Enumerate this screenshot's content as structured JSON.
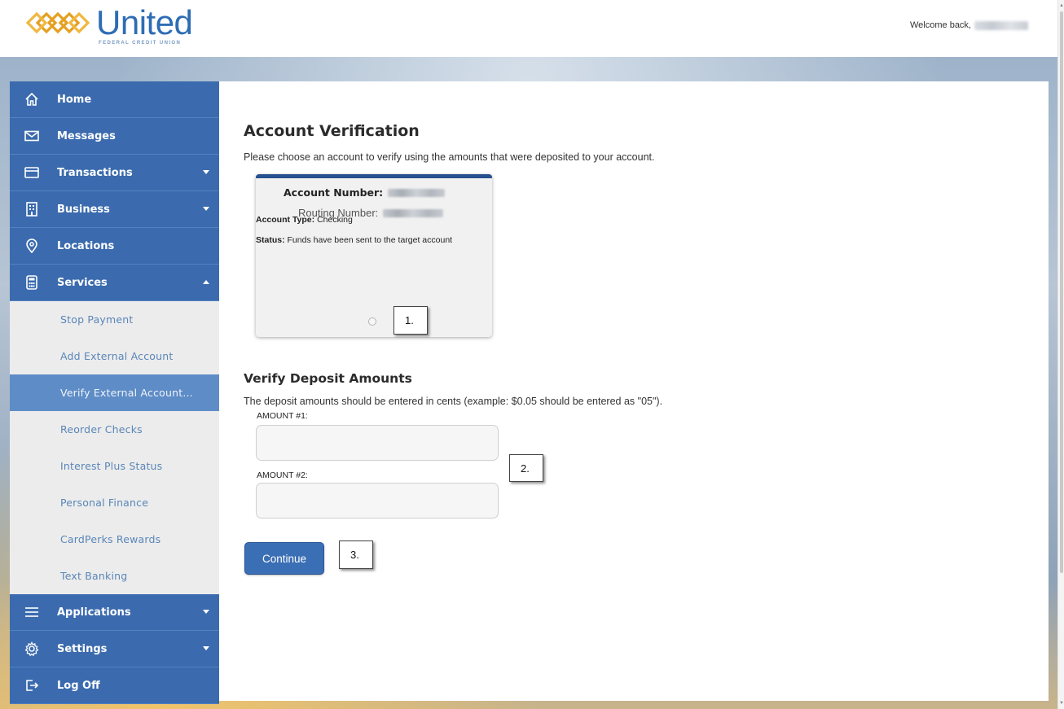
{
  "header": {
    "logo_name": "United",
    "logo_sub": "FEDERAL CREDIT UNION",
    "welcome": "Welcome back,"
  },
  "sidebar": {
    "items": [
      {
        "label": "Home",
        "icon": "home-icon"
      },
      {
        "label": "Messages",
        "icon": "envelope-icon"
      },
      {
        "label": "Transactions",
        "icon": "card-icon"
      },
      {
        "label": "Business",
        "icon": "building-icon"
      },
      {
        "label": "Locations",
        "icon": "map-pin-icon"
      },
      {
        "label": "Services",
        "icon": "calculator-icon"
      }
    ],
    "sub_items": [
      {
        "label": "Stop Payment"
      },
      {
        "label": "Add External Account"
      },
      {
        "label": "Verify External Account..."
      },
      {
        "label": "Reorder Checks"
      },
      {
        "label": "Interest Plus Status"
      },
      {
        "label": "Personal Finance"
      },
      {
        "label": "CardPerks Rewards"
      },
      {
        "label": "Text Banking"
      }
    ],
    "bottom_items": [
      {
        "label": "Applications",
        "icon": "menu-icon"
      },
      {
        "label": "Settings",
        "icon": "gear-icon"
      },
      {
        "label": "Log Off",
        "icon": "logout-icon"
      }
    ]
  },
  "main": {
    "title": "Account Verification",
    "description": "Please choose an account to verify using the amounts that were deposited to your account.",
    "card": {
      "account_number_label": "Account Number:",
      "routing_number_label": "Routing Number:",
      "account_type_label": "Account Type:",
      "account_type_value": "Checking",
      "status_label": "Status:",
      "status_value": "Funds have been sent to the target account"
    },
    "verify_title": "Verify Deposit Amounts",
    "verify_desc": "The deposit amounts should be entered in cents (example: $0.05 should be entered as \"05\").",
    "amount1_label": "AMOUNT #1:",
    "amount2_label": "AMOUNT #2:",
    "amount1_value": "",
    "amount2_value": "",
    "continue_label": "Continue"
  },
  "callouts": {
    "one": "1.",
    "two": "2.",
    "three": "3."
  },
  "colors": {
    "nav_blue": "#3b6bae",
    "active_sub": "#5e8cc7",
    "card_border": "#27508f",
    "button": "#3b6fb5"
  }
}
